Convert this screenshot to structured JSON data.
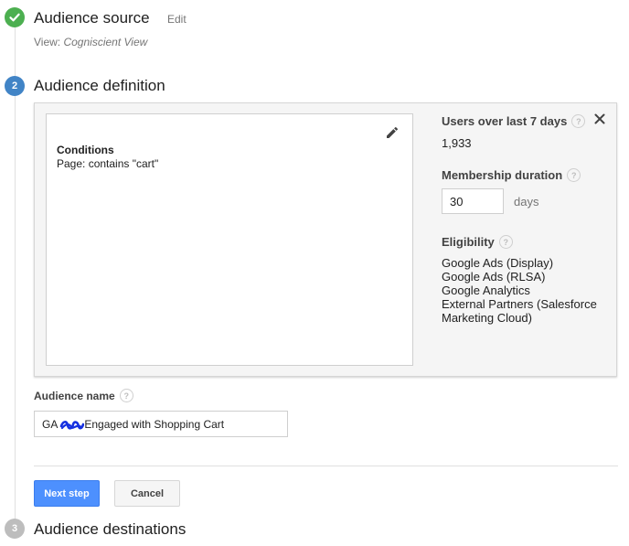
{
  "steps": {
    "source": {
      "title": "Audience source",
      "edit_label": "Edit",
      "view_prefix": "View: ",
      "view_name": "Cogniscient View"
    },
    "definition": {
      "number": "2",
      "title": "Audience definition"
    },
    "destinations": {
      "number": "3",
      "title": "Audience destinations"
    }
  },
  "conditions": {
    "heading": "Conditions",
    "rule": "Page: contains \"cart\""
  },
  "summary": {
    "users_label": "Users over last 7 days",
    "users_value": "1,933",
    "membership_label": "Membership duration",
    "membership_value": "30",
    "membership_unit": "days",
    "eligibility_label": "Eligibility",
    "eligibility_items": [
      "Google Ads (Display)",
      "Google Ads (RLSA)",
      "Google Analytics",
      "External Partners (Salesforce",
      "Marketing Cloud)"
    ]
  },
  "audience_name": {
    "label": "Audience name",
    "value_prefix": "GA",
    "value_suffix": "Engaged with Shopping Cart"
  },
  "buttons": {
    "next_label": "Next step",
    "cancel_label": "Cancel"
  },
  "colors": {
    "check_green": "#4caf50",
    "active_blue": "#4184c6",
    "inactive_grey": "#bdbdbd",
    "primary_button": "#4d90fe",
    "scribble_blue": "#1530e0"
  }
}
